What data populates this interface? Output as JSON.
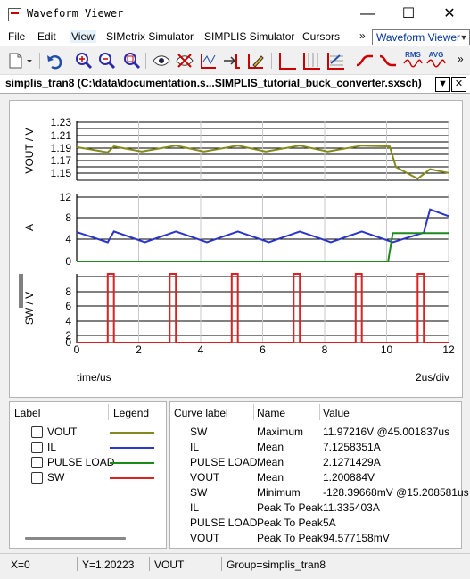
{
  "window": {
    "title": "Waveform Viewer",
    "minimize": "—",
    "maximize": "☐",
    "close": "✕"
  },
  "menu": {
    "items": [
      "File",
      "Edit",
      "View",
      "SIMetrix Simulator",
      "SIMPLIS Simulator",
      "Cursors"
    ],
    "overflow": "»",
    "combo_value": "Waveform Viewer"
  },
  "toolbar": {
    "icons": [
      "new-graph-icon",
      "dropdown-arrow-icon",
      "undo-icon",
      "zoom-in-icon",
      "zoom-out-icon",
      "zoom-fit-icon",
      "show-curve-icon",
      "hide-curve-icon",
      "curve-label-icon",
      "add-curve-icon",
      "edit-curve-icon",
      "axis-icon",
      "grid-icon",
      "stack-icon",
      "measure-rise-icon",
      "measure-fall-icon",
      "rms-icon",
      "avg-icon",
      "overflow-icon"
    ],
    "rms_label": "RMS",
    "avg_label": "AVG",
    "overflow": "»"
  },
  "doc_tab": {
    "title": "simplis_tran8 (C:\\data\\documentation.s...SIMPLIS_tutorial_buck_converter.sxsch)"
  },
  "chart_data": [
    {
      "type": "line",
      "ylabel": "VOUT / V",
      "ylim": [
        1.16,
        1.24
      ],
      "yticks": [
        "1.23",
        "1.21",
        "1.19",
        "1.17",
        "1.15"
      ],
      "series": [
        {
          "name": "VOUT",
          "color": "#858a1c",
          "points": [
            [
              0,
              1.205
            ],
            [
              1.0,
              1.198
            ],
            [
              1.2,
              1.206
            ],
            [
              2.1,
              1.199
            ],
            [
              3.2,
              1.207
            ],
            [
              4.1,
              1.199
            ],
            [
              5.2,
              1.207
            ],
            [
              6.1,
              1.199
            ],
            [
              7.2,
              1.207
            ],
            [
              8.1,
              1.199
            ],
            [
              9.2,
              1.207
            ],
            [
              10.1,
              1.206
            ],
            [
              10.3,
              1.178
            ],
            [
              11.0,
              1.162
            ],
            [
              11.4,
              1.175
            ],
            [
              12,
              1.17
            ]
          ]
        }
      ]
    },
    {
      "type": "line",
      "ylabel": "A",
      "ylim": [
        0,
        12
      ],
      "yticks": [
        "12",
        "8",
        "4",
        "0"
      ],
      "series": [
        {
          "name": "IL",
          "color": "#2b35c9",
          "points": [
            [
              0,
              5.2
            ],
            [
              1.0,
              3.4
            ],
            [
              1.2,
              5.3
            ],
            [
              2.2,
              3.4
            ],
            [
              3.2,
              5.3
            ],
            [
              4.2,
              3.4
            ],
            [
              5.2,
              5.3
            ],
            [
              6.2,
              3.4
            ],
            [
              7.2,
              5.3
            ],
            [
              8.2,
              3.4
            ],
            [
              9.2,
              5.3
            ],
            [
              10.2,
              3.4
            ],
            [
              11.2,
              5.1
            ],
            [
              11.4,
              9.2
            ],
            [
              12,
              8.0
            ]
          ]
        },
        {
          "name": "PULSE LOAD",
          "color": "#1b8a1b",
          "points": [
            [
              0,
              0
            ],
            [
              10.05,
              0
            ],
            [
              10.2,
              5
            ],
            [
              12,
              5
            ]
          ]
        }
      ]
    },
    {
      "type": "line",
      "ylabel": "SW / V",
      "ylim": [
        0,
        11
      ],
      "yticks": [
        "8",
        "6",
        "4",
        "2",
        "0"
      ],
      "series": [
        {
          "name": "SW",
          "color": "#e02020",
          "points": [
            [
              0,
              0
            ],
            [
              1.0,
              0
            ],
            [
              1.0,
              11
            ],
            [
              1.2,
              11
            ],
            [
              1.2,
              0
            ],
            [
              3.0,
              0
            ],
            [
              3.0,
              11
            ],
            [
              3.2,
              11
            ],
            [
              3.2,
              0
            ],
            [
              5.0,
              0
            ],
            [
              5.0,
              11
            ],
            [
              5.2,
              11
            ],
            [
              5.2,
              0
            ],
            [
              7.0,
              0
            ],
            [
              7.0,
              11
            ],
            [
              7.2,
              11
            ],
            [
              7.2,
              0
            ],
            [
              9.0,
              0
            ],
            [
              9.0,
              11
            ],
            [
              9.2,
              11
            ],
            [
              9.2,
              0
            ],
            [
              11.0,
              0
            ],
            [
              11.0,
              11
            ],
            [
              11.2,
              11
            ],
            [
              11.2,
              0
            ],
            [
              12,
              0
            ]
          ]
        }
      ]
    }
  ],
  "x_axis": {
    "xlim": [
      0,
      12
    ],
    "ticks": [
      "0",
      "2",
      "4",
      "6",
      "8",
      "10",
      "12"
    ],
    "label": "time/us",
    "scale": "2us/div"
  },
  "legend": {
    "headers": {
      "label": "Label",
      "legend": "Legend"
    },
    "items": [
      {
        "label": "VOUT",
        "color": "#858a1c"
      },
      {
        "label": "IL",
        "color": "#2b35c9"
      },
      {
        "label": "PULSE LOAD",
        "color": "#1b8a1b"
      },
      {
        "label": "SW",
        "color": "#e02020"
      }
    ]
  },
  "stats": {
    "headers": {
      "curve": "Curve label",
      "name": "Name",
      "value": "Value"
    },
    "rows": [
      {
        "curve": "SW",
        "name": "Maximum",
        "value": "11.97216V @45.001837us"
      },
      {
        "curve": "IL",
        "name": "Mean",
        "value": "7.1258351A"
      },
      {
        "curve": "PULSE LOAD",
        "name": "Mean",
        "value": "2.1271429A"
      },
      {
        "curve": "VOUT",
        "name": "Mean",
        "value": "1.200884V"
      },
      {
        "curve": "SW",
        "name": "Minimum",
        "value": "-128.39668mV @15.208581us"
      },
      {
        "curve": "IL",
        "name": "Peak To Peak",
        "value": "11.335403A"
      },
      {
        "curve": "PULSE LOAD",
        "name": "Peak To Peak",
        "value": "5A"
      },
      {
        "curve": "VOUT",
        "name": "Peak To Peak",
        "value": "94.577158mV"
      }
    ]
  },
  "status": {
    "x": "X=0",
    "y": "Y=1.20223",
    "curve": "VOUT",
    "group": "Group=simplis_tran8"
  }
}
